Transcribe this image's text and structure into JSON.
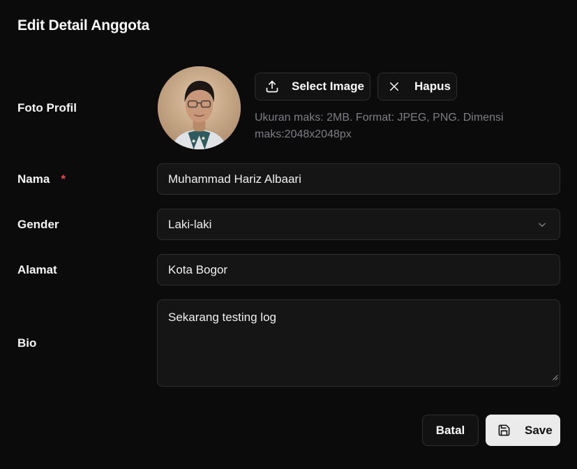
{
  "dialog": {
    "title": "Edit Detail Anggota"
  },
  "photo": {
    "label": "Foto Profil",
    "select_label": "Select Image",
    "remove_label": "Hapus",
    "hint": "Ukuran maks: 2MB. Format: JPEG, PNG. Dimensi maks:2048x2048px",
    "select_icon": "upload-icon",
    "remove_icon": "close-icon"
  },
  "fields": {
    "nama": {
      "label": "Nama",
      "required_mark": "*",
      "value": "Muhammad Hariz Albaari"
    },
    "gender": {
      "label": "Gender",
      "value": "Laki-laki",
      "icon": "chevron-down-icon"
    },
    "alamat": {
      "label": "Alamat",
      "value": "Kota Bogor"
    },
    "bio": {
      "label": "Bio",
      "value": "Sekarang testing log"
    }
  },
  "actions": {
    "cancel_label": "Batal",
    "save_label": "Save",
    "save_icon": "save-icon"
  },
  "colors": {
    "background": "#0b0b0b",
    "field_bg": "#151515",
    "border": "#2e2e2e",
    "required": "#e5484d",
    "hint": "#7d7d85",
    "primary_button": "#ebebeb"
  }
}
